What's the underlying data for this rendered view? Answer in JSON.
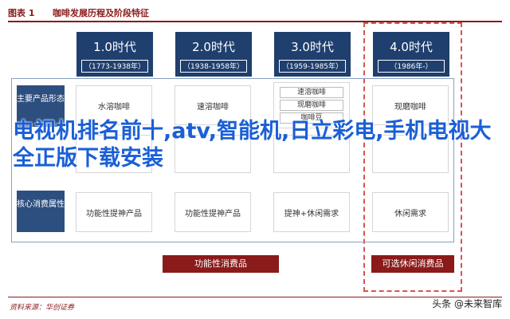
{
  "header": {
    "fig_label": "图表 1",
    "fig_title": "咖啡发展历程及阶段特征"
  },
  "eras": [
    {
      "name": "1.0时代",
      "years": "（1773-1938年）"
    },
    {
      "name": "2.0时代",
      "years": "（1938-1958年）"
    },
    {
      "name": "3.0时代",
      "years": "（1959-1985年）"
    },
    {
      "name": "4.0时代",
      "years": "（1986年-）"
    }
  ],
  "row_heads": [
    "主要产品形态",
    "",
    "核心消费属性"
  ],
  "cells": {
    "r1": [
      "水溶咖啡",
      "速溶咖啡",
      "",
      "现磨咖啡"
    ],
    "r1c3_lines": [
      "速溶咖啡",
      "现磨咖啡",
      "咖啡豆"
    ],
    "r3": [
      "功能性提神产品",
      "功能性提神产品",
      "提神+休闲需求",
      "休闲需求"
    ]
  },
  "footer_buttons": [
    "功能性消费品",
    "可选休闲消费品"
  ],
  "overlay_text": "电视机排名前十,atv,智能机,日立彩电,手机电视大全正版下载安装",
  "source": "资料来源：华创证券",
  "watermark": "头条 @未来智库"
}
